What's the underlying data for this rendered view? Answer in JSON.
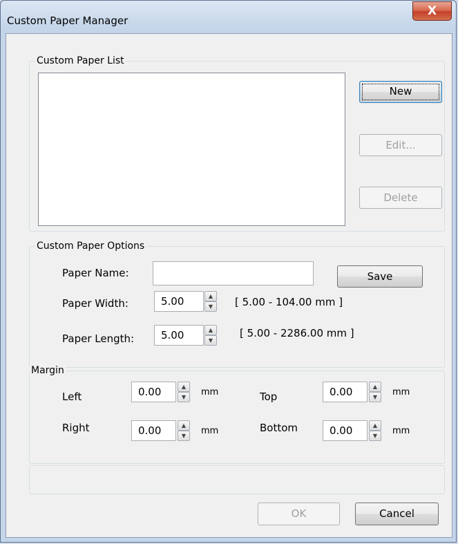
{
  "window": {
    "title": "Custom Paper Manager",
    "close_glyph": "X"
  },
  "paper_list": {
    "group_label": "Custom Paper List",
    "items": [],
    "new_label": "New",
    "edit_label": "Edit...",
    "delete_label": "Delete"
  },
  "options": {
    "group_label": "Custom Paper Options",
    "name_label": "Paper Name:",
    "name_value": "",
    "save_label": "Save",
    "width_label": "Paper Width:",
    "width_value": "5.00",
    "width_range": "[ 5.00 - 104.00 mm ]",
    "length_label": "Paper Length:",
    "length_value": "5.00",
    "length_range": "[ 5.00 - 2286.00 mm ]"
  },
  "margin": {
    "group_label": "Margin",
    "left_label": "Left",
    "left_value": "0.00",
    "top_label": "Top",
    "top_value": "0.00",
    "right_label": "Right",
    "right_value": "0.00",
    "bottom_label": "Bottom",
    "bottom_value": "0.00",
    "unit": "mm"
  },
  "footer": {
    "ok_label": "OK",
    "cancel_label": "Cancel"
  },
  "icons": {
    "spin_up": "spin-up-arrow-icon",
    "spin_down": "spin-down-arrow-icon",
    "close": "close-icon"
  }
}
